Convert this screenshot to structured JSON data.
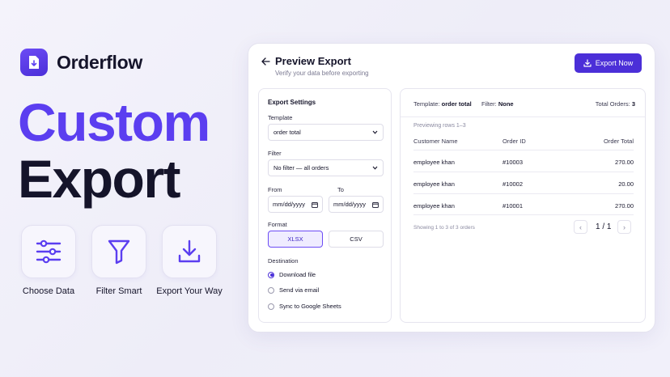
{
  "brand": {
    "name": "Orderflow"
  },
  "hero": {
    "line1": "Custom",
    "line2": "Export"
  },
  "features": [
    {
      "label": "Choose Data",
      "icon": "sliders-icon"
    },
    {
      "label": "Filter Smart",
      "icon": "funnel-icon"
    },
    {
      "label": "Export Your Way",
      "icon": "download-icon"
    }
  ],
  "card": {
    "title": "Preview Export",
    "subtitle": "Verify your data before exporting",
    "export_button": "Export Now"
  },
  "settings": {
    "heading": "Export Settings",
    "template_label": "Template",
    "template_value": "order total",
    "filter_label": "Filter",
    "filter_value": "No filter — all orders",
    "from_label": "From",
    "to_label": "To",
    "from_value": "mm/dd/yyyy",
    "to_value": "mm/dd/yyyy",
    "format_label": "Format",
    "format_options": [
      "XLSX",
      "CSV"
    ],
    "destination_label": "Destination",
    "destinations": [
      "Download file",
      "Send via email",
      "Sync to Google Sheets"
    ]
  },
  "preview": {
    "template_label": "Template:",
    "template_value": "order total",
    "filter_label": "Filter:",
    "filter_value": "None",
    "total_label": "Total Orders:",
    "total_value": "3",
    "rows_note": "Previewing rows 1–3",
    "columns": [
      "Customer Name",
      "Order ID",
      "Order Total"
    ],
    "rows": [
      [
        "employee khan",
        "#10003",
        "270.00"
      ],
      [
        "employee khan",
        "#10002",
        "20.00"
      ],
      [
        "employee khan",
        "#10001",
        "270.00"
      ]
    ],
    "footer": "Showing 1 to 3 of 3 orders",
    "page": "1 / 1"
  },
  "colors": {
    "accent": "#5b3ef0",
    "button": "#4b2fd8",
    "text": "#15142a"
  }
}
